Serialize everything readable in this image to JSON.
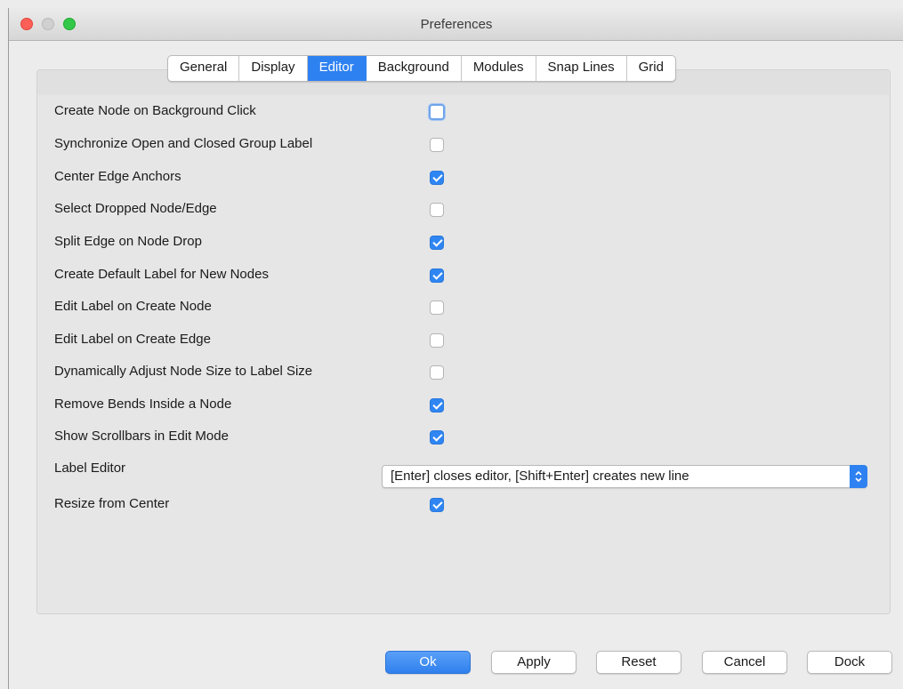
{
  "window": {
    "title": "Preferences"
  },
  "tabs": [
    {
      "label": "General",
      "active": false
    },
    {
      "label": "Display",
      "active": false
    },
    {
      "label": "Editor",
      "active": true
    },
    {
      "label": "Background",
      "active": false
    },
    {
      "label": "Modules",
      "active": false
    },
    {
      "label": "Snap Lines",
      "active": false
    },
    {
      "label": "Grid",
      "active": false
    }
  ],
  "options": [
    {
      "label": "Create Node on Background Click",
      "checked": false
    },
    {
      "label": "Synchronize Open and Closed Group Label",
      "checked": false
    },
    {
      "label": "Center Edge Anchors",
      "checked": true
    },
    {
      "label": "Select Dropped Node/Edge",
      "checked": false
    },
    {
      "label": "Split Edge on Node Drop",
      "checked": true
    },
    {
      "label": "Create Default Label for New Nodes",
      "checked": true
    },
    {
      "label": "Edit Label on Create Node",
      "checked": false
    },
    {
      "label": "Edit Label on Create Edge",
      "checked": false
    },
    {
      "label": "Dynamically Adjust Node Size to Label Size",
      "checked": false
    },
    {
      "label": "Remove Bends Inside a Node",
      "checked": true
    },
    {
      "label": "Show Scrollbars in Edit Mode",
      "checked": true
    }
  ],
  "label_editor": {
    "label": "Label Editor",
    "value": "[Enter] closes editor, [Shift+Enter] creates new line"
  },
  "resize_from_center": {
    "label": "Resize from Center",
    "checked": true
  },
  "buttons": {
    "ok": "Ok",
    "apply": "Apply",
    "reset": "Reset",
    "cancel": "Cancel",
    "dock": "Dock"
  },
  "colors": {
    "accent": "#2e81f0",
    "panel": "#e6e6e6",
    "window": "#ececec"
  }
}
